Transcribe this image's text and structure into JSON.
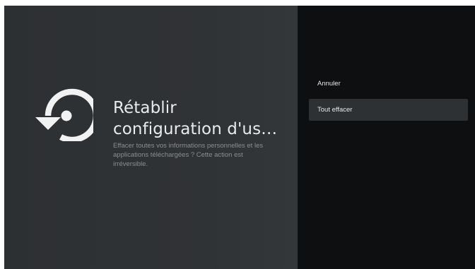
{
  "dialog": {
    "title_line1": "Rétablir",
    "title_line2": "configuration d'us…",
    "description": "Effacer toutes vos informations personnelles et les applications téléchargées ? Cette action est irréversible."
  },
  "actions": {
    "cancel_label": "Annuler",
    "erase_all_label": "Tout effacer",
    "focused": "erase_all"
  },
  "icons": {
    "main": "restore-icon"
  },
  "colors": {
    "left_panel": "#303336",
    "right_panel": "#0e0f10",
    "focused_item": "#2e3134",
    "title_text": "#e9eaeb",
    "description_text": "#8b8e91"
  }
}
